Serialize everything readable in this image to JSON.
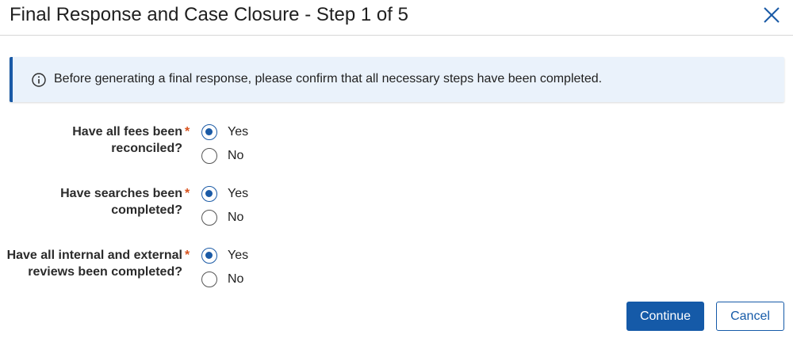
{
  "dialog": {
    "title": "Final Response and Case Closure - Step 1 of 5",
    "close_icon": "close-icon"
  },
  "banner": {
    "icon": "info-icon",
    "text": "Before generating a final response, please confirm that all necessary steps have been completed."
  },
  "questions": [
    {
      "label_line1": "Have all fees been",
      "label_line2": "reconciled?",
      "required": "*",
      "selected": "Yes",
      "options": [
        "Yes",
        "No"
      ]
    },
    {
      "label_line1": "Have searches been",
      "label_line2": "completed?",
      "required": "*",
      "selected": "Yes",
      "options": [
        "Yes",
        "No"
      ]
    },
    {
      "label_line1": "Have all internal and external",
      "label_line2": "reviews been completed?",
      "required": "*",
      "selected": "Yes",
      "options": [
        "Yes",
        "No"
      ]
    }
  ],
  "actions": {
    "continue_label": "Continue",
    "cancel_label": "Cancel"
  },
  "colors": {
    "accent": "#155aa8",
    "banner_bg": "#eaf2fb",
    "required": "#d9531e"
  }
}
